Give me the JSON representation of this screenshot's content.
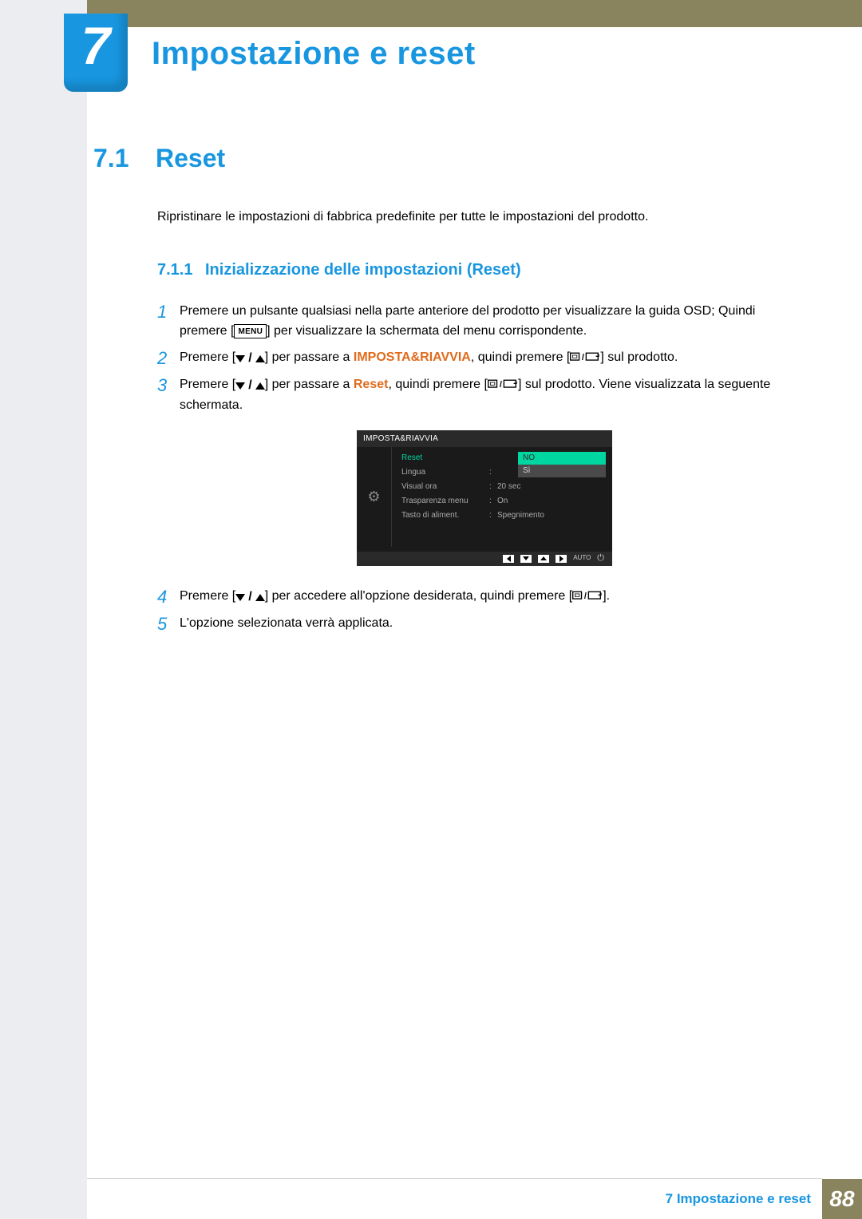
{
  "chapter": {
    "number": "7",
    "title": "Impostazione e reset"
  },
  "section": {
    "number": "7.1",
    "title": "Reset"
  },
  "intro": "Ripristinare le impostazioni di fabbrica predefinite per tutte le impostazioni del prodotto.",
  "subsection": {
    "number": "7.1.1",
    "title": "Inizializzazione delle impostazioni (Reset)"
  },
  "steps": {
    "s1a": "Premere un pulsante qualsiasi nella parte anteriore del prodotto per visualizzare la guida OSD; Quindi premere [",
    "s1b": "] per visualizzare la schermata del menu corrispondente.",
    "s2a": "Premere [",
    "s2b": "] per passare a ",
    "s2hl": "IMPOSTA&RIAVVIA",
    "s2c": ", quindi premere [",
    "s2d": "] sul prodotto.",
    "s3a": "Premere [",
    "s3b": "] per passare a ",
    "s3hl": "Reset",
    "s3c": ", quindi premere [",
    "s3d": "] sul prodotto. Viene visualizzata la seguente schermata.",
    "s4a": "Premere [",
    "s4b": "] per accedere all'opzione desiderata, quindi premere [",
    "s4c": "].",
    "s5": "L'opzione selezionata verrà applicata."
  },
  "menu_label": "MENU",
  "osd": {
    "title": "IMPOSTA&RIAVVIA",
    "opt_no": "NO",
    "opt_si": "Sì",
    "rows": [
      {
        "label": "Reset",
        "value": ""
      },
      {
        "label": "Lingua",
        "value": ""
      },
      {
        "label": "Visual ora",
        "value": "20 sec"
      },
      {
        "label": "Trasparenza menu",
        "value": "On"
      },
      {
        "label": "Tasto di aliment.",
        "value": "Spegnimento"
      }
    ],
    "auto": "AUTO"
  },
  "footer": {
    "text": "7 Impostazione e reset",
    "page": "88"
  }
}
